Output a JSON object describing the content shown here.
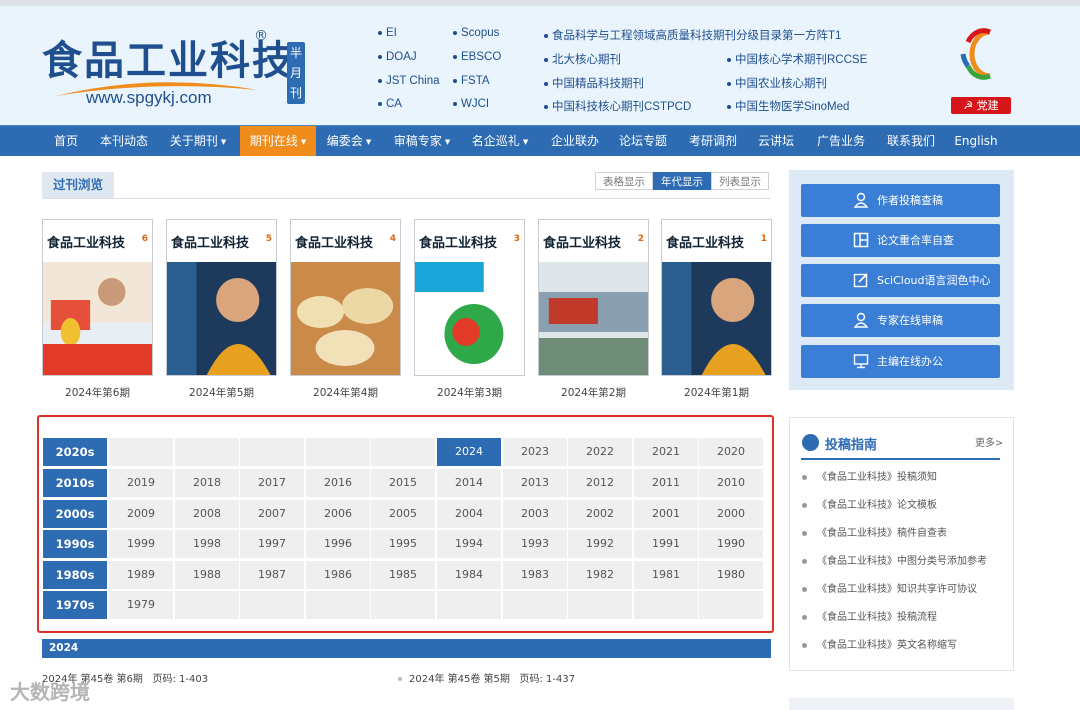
{
  "header": {
    "logo_text": "食品工业科技",
    "logo_reg": "®",
    "logo_url": "www.spgykj.com",
    "half_month_label": [
      "半",
      "月",
      "刊"
    ],
    "index_col1": [
      "EI",
      "DOAJ",
      "JST China",
      "CA"
    ],
    "index_col2": [
      "Scopus",
      "EBSCO",
      "FSTA",
      "WJCI"
    ],
    "honors_col1": [
      "食品科学与工程领域高质量科技期刊分级目录第一方阵T1",
      "北大核心期刊",
      "中国精品科技期刊",
      "中国科技核心期刊CSTPCD"
    ],
    "honors_col2": [
      "中国核心学术期刊RCCSE",
      "中国农业核心期刊",
      "中国生物医学SinoMed"
    ],
    "party_button": "党建",
    "colors": {
      "brand_blue": "#2d6bb3",
      "accent_orange": "#f08c1c",
      "party_red": "#d7161b"
    }
  },
  "nav": {
    "items": [
      {
        "label": "首页",
        "has_menu": false
      },
      {
        "label": "本刊动态",
        "has_menu": false
      },
      {
        "label": "关于期刊",
        "has_menu": true
      },
      {
        "label": "期刊在线",
        "has_menu": true,
        "active": true
      },
      {
        "label": "编委会",
        "has_menu": true
      },
      {
        "label": "审稿专家",
        "has_menu": true
      },
      {
        "label": "名企巡礼",
        "has_menu": true
      },
      {
        "label": "企业联办",
        "has_menu": false
      },
      {
        "label": "论坛专题",
        "has_menu": false
      },
      {
        "label": "考研调剂",
        "has_menu": false
      },
      {
        "label": "云讲坛",
        "has_menu": false
      },
      {
        "label": "广告业务",
        "has_menu": false
      },
      {
        "label": "联系我们",
        "has_menu": false
      },
      {
        "label": "English",
        "has_menu": false
      }
    ]
  },
  "browse": {
    "tab_label": "过刊浏览",
    "view_buttons": [
      {
        "label": "表格显示",
        "active": false
      },
      {
        "label": "年代显示",
        "active": true
      },
      {
        "label": "列表显示",
        "active": false
      }
    ]
  },
  "covers": [
    {
      "caption": "2024年第6期",
      "issue": "6"
    },
    {
      "caption": "2024年第5期",
      "issue": "5"
    },
    {
      "caption": "2024年第4期",
      "issue": "4"
    },
    {
      "caption": "2024年第3期",
      "issue": "3"
    },
    {
      "caption": "2024年第2期",
      "issue": "2"
    },
    {
      "caption": "2024年第1期",
      "issue": "1"
    }
  ],
  "decades": [
    {
      "label": "2020s",
      "years": [
        "",
        "",
        "",
        "",
        "",
        "2024",
        "2023",
        "2022",
        "2021",
        "2020"
      ]
    },
    {
      "label": "2010s",
      "years": [
        "2019",
        "2018",
        "2017",
        "2016",
        "2015",
        "2014",
        "2013",
        "2012",
        "2011",
        "2010"
      ]
    },
    {
      "label": "2000s",
      "years": [
        "2009",
        "2008",
        "2007",
        "2006",
        "2005",
        "2004",
        "2003",
        "2002",
        "2001",
        "2000"
      ]
    },
    {
      "label": "1990s",
      "years": [
        "1999",
        "1998",
        "1997",
        "1996",
        "1995",
        "1994",
        "1993",
        "1992",
        "1991",
        "1990"
      ]
    },
    {
      "label": "1980s",
      "years": [
        "1989",
        "1988",
        "1987",
        "1986",
        "1985",
        "1984",
        "1983",
        "1982",
        "1981",
        "1980"
      ]
    },
    {
      "label": "1970s",
      "years": [
        "1979",
        "",
        "",
        "",
        "",
        "",
        "",
        "",
        "",
        ""
      ]
    }
  ],
  "selected_year": "2024",
  "year_section": {
    "label": "2024",
    "issues": [
      {
        "text": "2024年 第45卷 第6期",
        "pages": "页码: 1-403"
      },
      {
        "text": "2024年 第45卷 第5期",
        "pages": "页码: 1-437"
      }
    ]
  },
  "sidebar": {
    "buttons": [
      {
        "label": "作者投稿查稿",
        "icon": "user-icon"
      },
      {
        "label": "论文重合率自查",
        "icon": "layout-icon"
      },
      {
        "label": "SciCloud语言润色中心",
        "icon": "edit-icon"
      },
      {
        "label": "专家在线审稿",
        "icon": "user-icon"
      },
      {
        "label": "主编在线办公",
        "icon": "monitor-icon"
      }
    ],
    "guide": {
      "title": "投稿指南",
      "more": "更多>",
      "items": [
        "《食品工业科技》投稿须知",
        "《食品工业科技》论文模板",
        "《食品工业科技》稿件自查表",
        "《食品工业科技》中图分类号添加参考",
        "《食品工业科技》知识共享许可协议",
        "《食品工业科技》投稿流程",
        "《食品工业科技》英文名称缩写"
      ]
    }
  },
  "watermark": "大数跨境"
}
